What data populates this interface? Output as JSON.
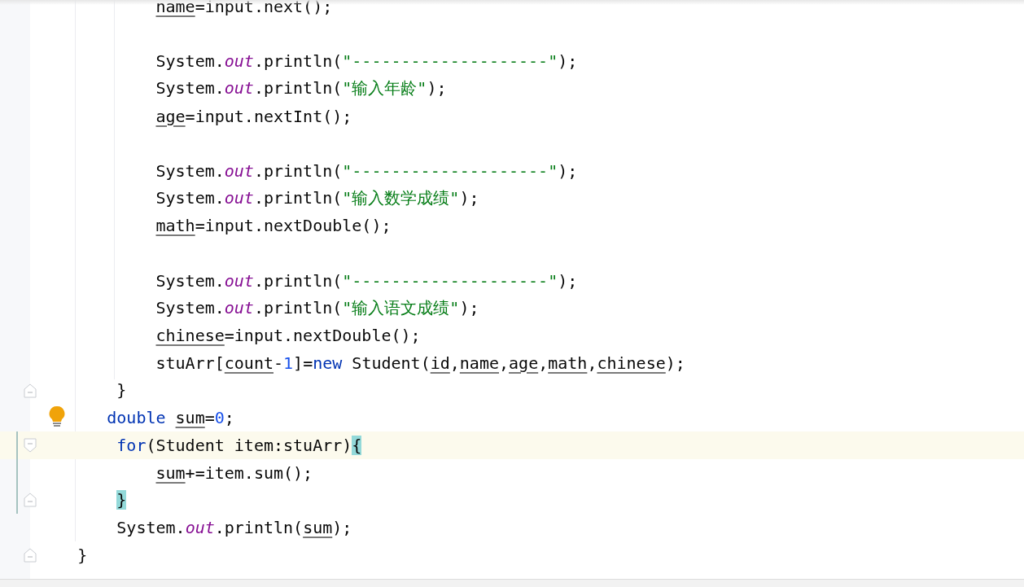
{
  "editor": {
    "lines": [
      {
        "current": false,
        "changed": false,
        "tokens": [
          {
            "kind": "var",
            "text": "            name"
          },
          {
            "kind": "plain",
            "text": "=input.next();"
          }
        ]
      },
      {
        "current": false,
        "changed": false
      },
      {
        "current": false,
        "changed": false,
        "tokens": [
          {
            "kind": "plain",
            "text": "            System."
          },
          {
            "kind": "field",
            "text": "out"
          },
          {
            "kind": "plain",
            "text": ".println("
          },
          {
            "kind": "str",
            "text": "\"--------------------\""
          },
          {
            "kind": "plain",
            "text": ");"
          }
        ]
      },
      {
        "current": false,
        "changed": false,
        "tokens": [
          {
            "kind": "plain",
            "text": "            System."
          },
          {
            "kind": "field",
            "text": "out"
          },
          {
            "kind": "plain",
            "text": ".println("
          },
          {
            "kind": "str",
            "text": "\"输入年龄\""
          },
          {
            "kind": "plain",
            "text": ");"
          }
        ]
      },
      {
        "current": false,
        "changed": false,
        "tokens": [
          {
            "kind": "var",
            "text": "            age"
          },
          {
            "kind": "plain",
            "text": "=input.nextInt();"
          }
        ]
      },
      {
        "current": false,
        "changed": false
      },
      {
        "current": false,
        "changed": false,
        "tokens": [
          {
            "kind": "plain",
            "text": "            System."
          },
          {
            "kind": "field",
            "text": "out"
          },
          {
            "kind": "plain",
            "text": ".println("
          },
          {
            "kind": "str",
            "text": "\"--------------------\""
          },
          {
            "kind": "plain",
            "text": ");"
          }
        ]
      },
      {
        "current": false,
        "changed": false,
        "tokens": [
          {
            "kind": "plain",
            "text": "            System."
          },
          {
            "kind": "field",
            "text": "out"
          },
          {
            "kind": "plain",
            "text": ".println("
          },
          {
            "kind": "str",
            "text": "\"输入数学成绩\""
          },
          {
            "kind": "plain",
            "text": ");"
          }
        ]
      },
      {
        "current": false,
        "changed": false,
        "tokens": [
          {
            "kind": "var",
            "text": "            math"
          },
          {
            "kind": "plain",
            "text": "=input.nextDouble();"
          }
        ]
      },
      {
        "current": false,
        "changed": false
      },
      {
        "current": false,
        "changed": false,
        "tokens": [
          {
            "kind": "plain",
            "text": "            System."
          },
          {
            "kind": "field",
            "text": "out"
          },
          {
            "kind": "plain",
            "text": ".println("
          },
          {
            "kind": "str",
            "text": "\"--------------------\""
          },
          {
            "kind": "plain",
            "text": ");"
          }
        ]
      },
      {
        "current": false,
        "changed": false,
        "tokens": [
          {
            "kind": "plain",
            "text": "            System."
          },
          {
            "kind": "field",
            "text": "out"
          },
          {
            "kind": "plain",
            "text": ".println("
          },
          {
            "kind": "str",
            "text": "\"输入语文成绩\""
          },
          {
            "kind": "plain",
            "text": ");"
          }
        ]
      },
      {
        "current": false,
        "changed": false,
        "tokens": [
          {
            "kind": "var",
            "text": "            chinese"
          },
          {
            "kind": "plain",
            "text": "=input.nextDouble();"
          }
        ]
      },
      {
        "current": false,
        "changed": false,
        "tokens": [
          {
            "kind": "plain",
            "text": "            stuArr["
          },
          {
            "kind": "var",
            "text": "count"
          },
          {
            "kind": "plain",
            "text": "-"
          },
          {
            "kind": "num",
            "text": "1"
          },
          {
            "kind": "plain",
            "text": "]="
          },
          {
            "kind": "kw",
            "text": "new"
          },
          {
            "kind": "plain",
            "text": " Student("
          },
          {
            "kind": "var",
            "text": "id"
          },
          {
            "kind": "plain",
            "text": ","
          },
          {
            "kind": "var",
            "text": "name"
          },
          {
            "kind": "plain",
            "text": ","
          },
          {
            "kind": "var",
            "text": "age"
          },
          {
            "kind": "plain",
            "text": ","
          },
          {
            "kind": "var",
            "text": "math"
          },
          {
            "kind": "plain",
            "text": ","
          },
          {
            "kind": "var",
            "text": "chinese"
          },
          {
            "kind": "plain",
            "text": ");"
          }
        ]
      },
      {
        "current": false,
        "changed": false,
        "gutter_icon": {
          "kind": "fold-end"
        },
        "tokens": [
          {
            "kind": "plain",
            "text": "        }"
          }
        ]
      },
      {
        "current": false,
        "changed": false,
        "gutter_icon": {
          "kind": "bulb"
        },
        "tokens": [
          {
            "kind": "kw",
            "text": "       double "
          },
          {
            "kind": "var",
            "text": "sum"
          },
          {
            "kind": "plain",
            "text": "="
          },
          {
            "kind": "num",
            "text": "0"
          },
          {
            "kind": "plain",
            "text": ";"
          }
        ]
      },
      {
        "current": true,
        "changed": true,
        "gutter_icon": {
          "kind": "fold-start"
        },
        "tokens": [
          {
            "kind": "kw",
            "text": "        for"
          },
          {
            "kind": "plain",
            "text": "(Student item:stuArr)"
          },
          {
            "kind": "brace",
            "text": "{"
          }
        ]
      },
      {
        "current": false,
        "changed": true,
        "tokens": [
          {
            "kind": "var",
            "text": "            sum"
          },
          {
            "kind": "plain",
            "text": "+=item.sum();"
          }
        ]
      },
      {
        "current": false,
        "changed": true,
        "gutter_icon": {
          "kind": "fold-end"
        },
        "tokens": [
          {
            "kind": "brace",
            "text": "        }"
          }
        ]
      },
      {
        "current": false,
        "changed": false,
        "tokens": [
          {
            "kind": "plain",
            "text": "        System."
          },
          {
            "kind": "field",
            "text": "out"
          },
          {
            "kind": "plain",
            "text": ".println("
          },
          {
            "kind": "var",
            "text": "sum"
          },
          {
            "kind": "plain",
            "text": ");"
          }
        ]
      },
      {
        "current": false,
        "changed": false,
        "gutter_icon": {
          "kind": "fold-end"
        },
        "tokens": [
          {
            "kind": "plain",
            "text": "    }"
          }
        ]
      }
    ]
  }
}
